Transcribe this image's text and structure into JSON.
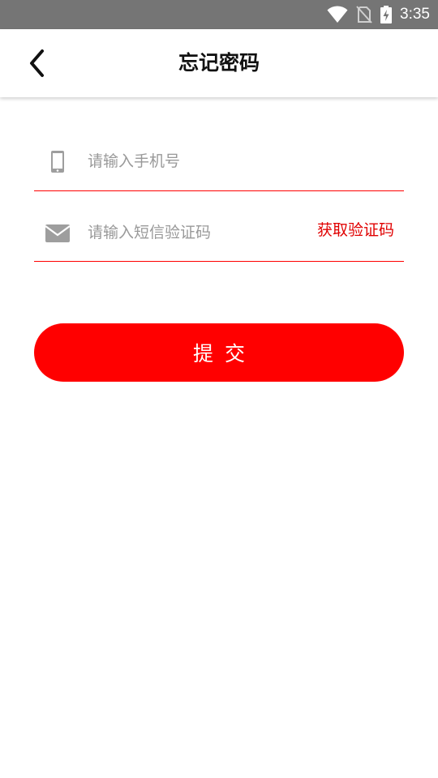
{
  "status_bar": {
    "time": "3:35",
    "icons": [
      "wifi-icon",
      "no-sim-icon",
      "battery-charging-icon"
    ]
  },
  "header": {
    "title": "忘记密码",
    "back_icon": "chevron-left-icon"
  },
  "form": {
    "phone": {
      "icon": "mobile-phone-icon",
      "placeholder": "请输入手机号",
      "value": ""
    },
    "code": {
      "icon": "envelope-icon",
      "placeholder": "请输入短信验证码",
      "value": "",
      "get_code_label": "获取验证码"
    },
    "submit_label": "提交"
  },
  "colors": {
    "accent": "#ff0000",
    "status_bar": "#757575",
    "icon_gray": "#9e9e9e",
    "placeholder": "#999999"
  }
}
